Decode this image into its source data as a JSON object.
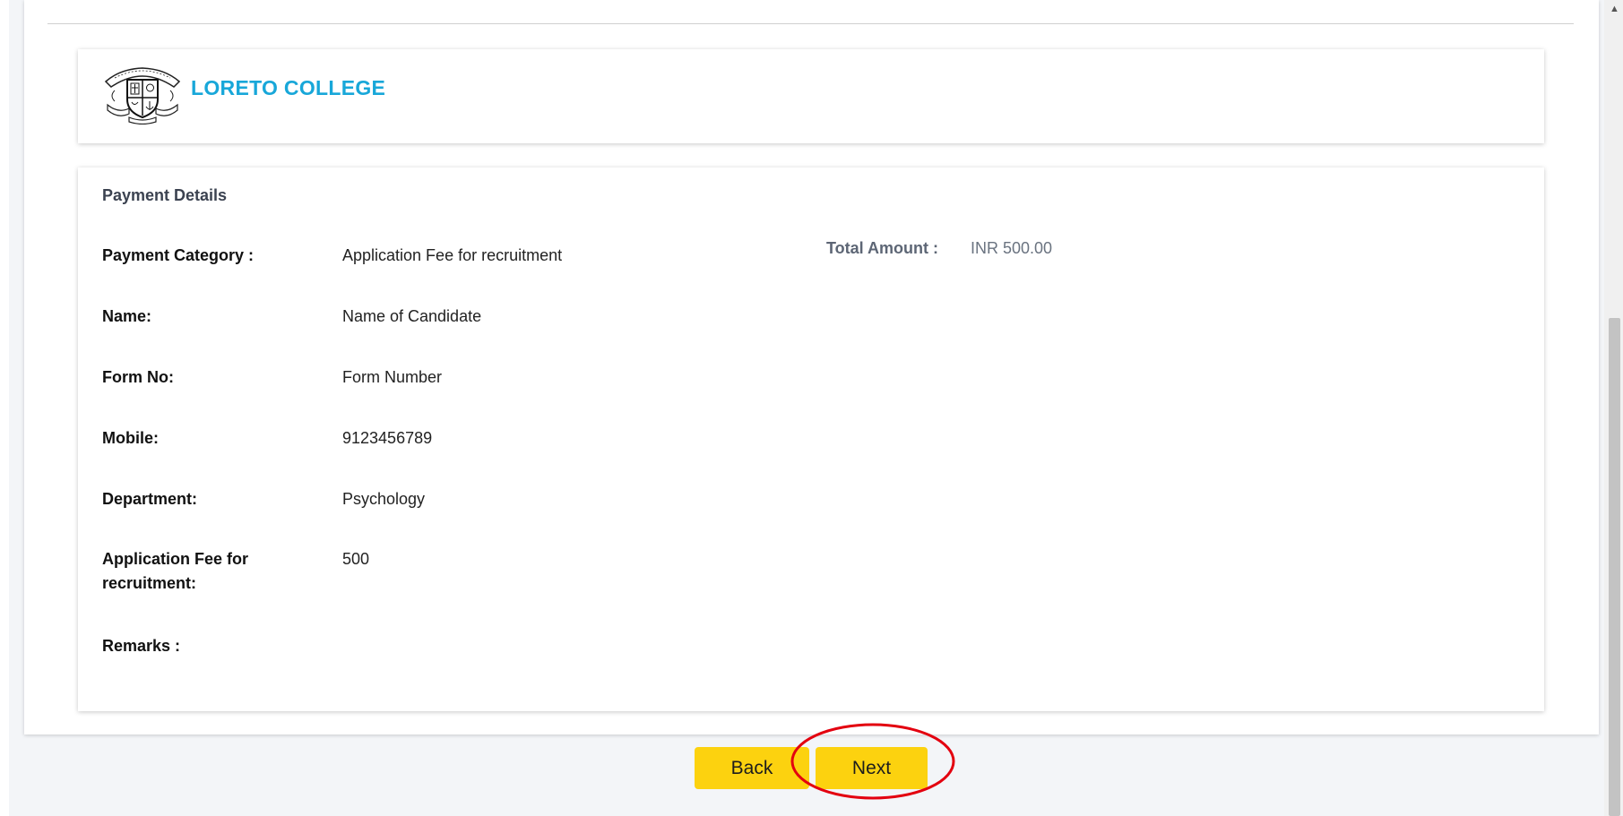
{
  "header": {
    "college_name": "LORETO COLLEGE"
  },
  "payment": {
    "section_title": "Payment Details",
    "total_amount_label": "Total Amount :",
    "total_amount_value": "INR 500.00",
    "fields": [
      {
        "label": "Payment Category :",
        "value": "Application Fee for recruitment"
      },
      {
        "label": "Name:",
        "value": "Name of Candidate"
      },
      {
        "label": "Form No:",
        "value": "Form Number"
      },
      {
        "label": "Mobile:",
        "value": "9123456789"
      },
      {
        "label": "Department:",
        "value": "Psychology"
      },
      {
        "label": "Application Fee for recruitment:",
        "value": "500"
      },
      {
        "label": "Remarks :",
        "value": ""
      }
    ]
  },
  "actions": {
    "back_label": "Back",
    "next_label": "Next"
  },
  "colors": {
    "brand": "#18a7d9",
    "button": "#fcd20f",
    "highlight_ring": "#e3000f"
  },
  "icons": {
    "logo": "college-crest-logo",
    "scroll_up": "scroll-up-arrow-icon"
  }
}
